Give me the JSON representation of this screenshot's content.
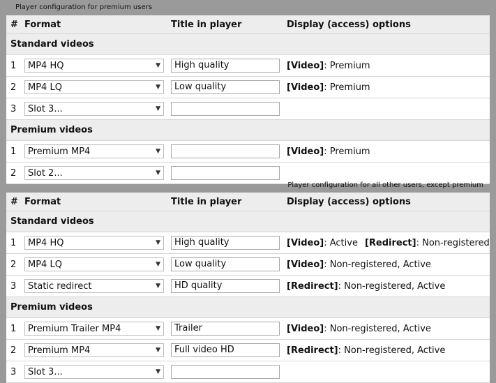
{
  "premium": {
    "caption": "Player configuration for premium users",
    "headers": [
      "#",
      "Format",
      "Title in player",
      "Display (access) options"
    ],
    "sections": [
      {
        "label": "Standard videos",
        "rows": [
          {
            "num": "1",
            "format": "MP4 HQ",
            "title": "High quality",
            "options": [
              {
                "tag": "[Video]",
                "value": ": Premium"
              }
            ]
          },
          {
            "num": "2",
            "format": "MP4 LQ",
            "title": "Low quality",
            "options": [
              {
                "tag": "[Video]",
                "value": ": Premium"
              }
            ]
          },
          {
            "num": "3",
            "format": "Slot 3...",
            "title": "",
            "options": []
          }
        ]
      },
      {
        "label": "Premium videos",
        "rows": [
          {
            "num": "1",
            "format": "Premium MP4",
            "title": "",
            "options": [
              {
                "tag": "[Video]",
                "value": ": Premium"
              }
            ]
          },
          {
            "num": "2",
            "format": "Slot 2...",
            "title": "",
            "options": []
          }
        ]
      }
    ]
  },
  "others": {
    "caption": "Player configuration for all other users, except premium",
    "headers": [
      "#",
      "Format",
      "Title in player",
      "Display (access) options"
    ],
    "sections": [
      {
        "label": "Standard videos",
        "rows": [
          {
            "num": "1",
            "format": "MP4 HQ",
            "title": "High quality",
            "options": [
              {
                "tag": "[Video]",
                "value": ": Active"
              },
              {
                "tag": "[Redirect]",
                "value": ": Non-registered"
              }
            ]
          },
          {
            "num": "2",
            "format": "MP4 LQ",
            "title": "Low quality",
            "options": [
              {
                "tag": "[Video]",
                "value": ": Non-registered, Active"
              }
            ]
          },
          {
            "num": "3",
            "format": "Static redirect",
            "title": "HD quality",
            "options": [
              {
                "tag": "[Redirect]",
                "value": ": Non-registered, Active"
              }
            ]
          }
        ]
      },
      {
        "label": "Premium videos",
        "rows": [
          {
            "num": "1",
            "format": "Premium Trailer MP4",
            "title": "Trailer",
            "options": [
              {
                "tag": "[Video]",
                "value": ": Non-registered, Active"
              }
            ]
          },
          {
            "num": "2",
            "format": "Premium MP4",
            "title": "Full video HD",
            "options": [
              {
                "tag": "[Redirect]",
                "value": ": Non-registered, Active"
              }
            ]
          },
          {
            "num": "3",
            "format": "Slot 3...",
            "title": "",
            "options": []
          }
        ]
      }
    ]
  },
  "icons": {
    "dropdown": "chevron-down-icon",
    "dropdown_glyph": "▼"
  }
}
